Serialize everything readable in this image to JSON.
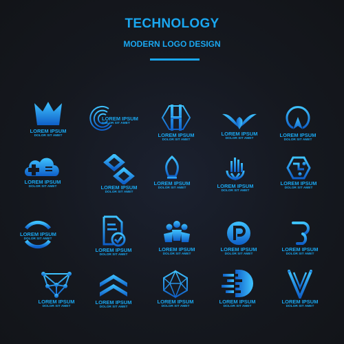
{
  "header": {
    "title": "TECHNOLOGY",
    "subtitle": "MODERN LOGO DESIGN"
  },
  "colors": {
    "accent": "#1aa7f0",
    "accent_light": "#3fc3ff",
    "accent_dark": "#0f5fc8",
    "background": "#15181f"
  },
  "logos": [
    {
      "icon": "crown-icon",
      "name": "LOREM IPSUM",
      "tagline": "DOLOR SIT AMET"
    },
    {
      "icon": "swirl-rings-icon",
      "name": "LOREM IPSUM",
      "tagline": "DOLOR SIT AMET"
    },
    {
      "icon": "hexagon-h-icon",
      "name": "LOREM IPSUM",
      "tagline": "DOLOR SIT AMET"
    },
    {
      "icon": "wings-icon",
      "name": "LOREM IPSUM",
      "tagline": "DOLOR SIT AMET"
    },
    {
      "icon": "ring-arrow-icon",
      "name": "LOREM IPSUM",
      "tagline": "DOLOR SIT AMET"
    },
    {
      "icon": "cloud-plus-icon",
      "name": "LOREM IPSUM",
      "tagline": "DOLOR SIT AMET"
    },
    {
      "icon": "chain-links-icon",
      "name": "LOREM IPSUM",
      "tagline": "DOLOR SIT AMET"
    },
    {
      "icon": "pen-nib-icon",
      "name": "LOREM IPSUM",
      "tagline": "DOLOR SIT AMET"
    },
    {
      "icon": "city-shield-icon",
      "name": "LOREM IPSUM",
      "tagline": "DOLOR SIT AMET"
    },
    {
      "icon": "hex-circuit-icon",
      "name": "LOREM IPSUM",
      "tagline": "DOLOR SIT AMET"
    },
    {
      "icon": "ring-icon",
      "name": "LOREM IPSUM",
      "tagline": "DOLOR SIT AMET"
    },
    {
      "icon": "document-check-icon",
      "name": "LOREM IPSUM",
      "tagline": "DOLOR SIT AMET"
    },
    {
      "icon": "people-group-icon",
      "name": "LOREM IPSUM",
      "tagline": "DOLOR SIT AMET"
    },
    {
      "icon": "letter-p-icon",
      "name": "LOREM IPSUM",
      "tagline": "DOLOR SIT AMET"
    },
    {
      "icon": "speed-lines-icon",
      "name": "LOREM IPSUM",
      "tagline": "DOLOR SIT AMET"
    },
    {
      "icon": "network-nodes-icon",
      "name": "LOREM IPSUM",
      "tagline": "DOLOR SIT AMET"
    },
    {
      "icon": "chevrons-up-icon",
      "name": "LOREM IPSUM",
      "tagline": "DOLOR SIT AMET"
    },
    {
      "icon": "polyhedron-icon",
      "name": "LOREM IPSUM",
      "tagline": "DOLOR SIT AMET"
    },
    {
      "icon": "fast-d-icon",
      "name": "LOREM IPSUM",
      "tagline": "DOLOR SIT AMET"
    },
    {
      "icon": "v-lines-icon",
      "name": "LOREM IPSUM",
      "tagline": "DOLOR SIT AMET"
    }
  ]
}
